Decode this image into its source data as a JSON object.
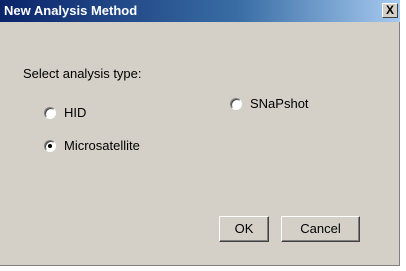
{
  "window": {
    "title": "New Analysis Method",
    "close_label": "X"
  },
  "form": {
    "prompt": "Select analysis type:",
    "options": [
      {
        "label": "HID",
        "checked": false
      },
      {
        "label": "Microsatellite",
        "checked": true
      },
      {
        "label": "SNaPshot",
        "checked": false
      }
    ]
  },
  "buttons": {
    "ok_label": "OK",
    "cancel_label": "Cancel"
  }
}
